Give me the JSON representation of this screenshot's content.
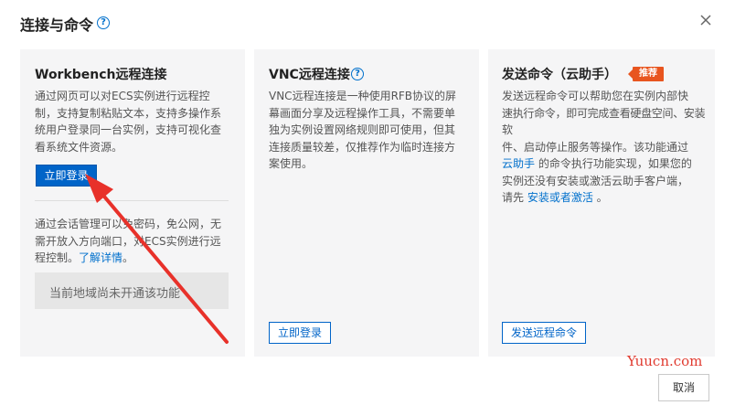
{
  "dialog": {
    "title": "连接与命令",
    "help_glyph": "?",
    "close_icon": "close-icon"
  },
  "workbench": {
    "title": "Workbench远程连接",
    "desc_lines": [
      "通过网页可以对ECS实例进行远程控",
      "制，支持复制粘贴文本，支持多操作系",
      "统用户登录同一台实例，支持可视化查",
      "看系统文件资源。"
    ],
    "login_label": "立即登录",
    "session_lines": [
      "通过会话管理可以免密码，免公网，无",
      "需开放入方向端口，对ECS实例进行远"
    ],
    "session_tail": "程控制。",
    "learn_more": "了解详情",
    "session_end": "。",
    "disabled_text": "当前地域尚未开通该功能"
  },
  "vnc": {
    "title": "VNC远程连接",
    "desc_lines": [
      "VNC远程连接是一种使用RFB协议的屏",
      "幕画面分享及远程操作工具，不需要单",
      "独为实例设置网络规则即可使用，但其",
      "连接质量较差，仅推荐作为临时连接方",
      "案使用。"
    ],
    "login_label": "立即登录"
  },
  "cloud_assistant": {
    "title": "发送命令（云助手）",
    "badge": "推荐",
    "desc_lines": [
      "发送远程命令可以帮助您在实例内部快",
      "速执行命令，即可完成查看硬盘空间、安装软",
      "件、启动停止服务等操作。该功能通过"
    ],
    "link_assistant": "云助手",
    "line4_rest": " 的命令执行功能实现，如果您的",
    "line5": "实例还没有安装或激活云助手客户端，",
    "line6_prefix": "请先 ",
    "link_install": "安装或者激活",
    "line6_suffix": " 。",
    "send_label": "发送远程命令"
  },
  "footer": {
    "cancel_label": "取消",
    "watermark": "Yuucn.com"
  },
  "colors": {
    "accent": "#0064c8",
    "badge": "#e8551f",
    "arrow": "#e8312a",
    "panel_bg": "#f5f5f6"
  }
}
